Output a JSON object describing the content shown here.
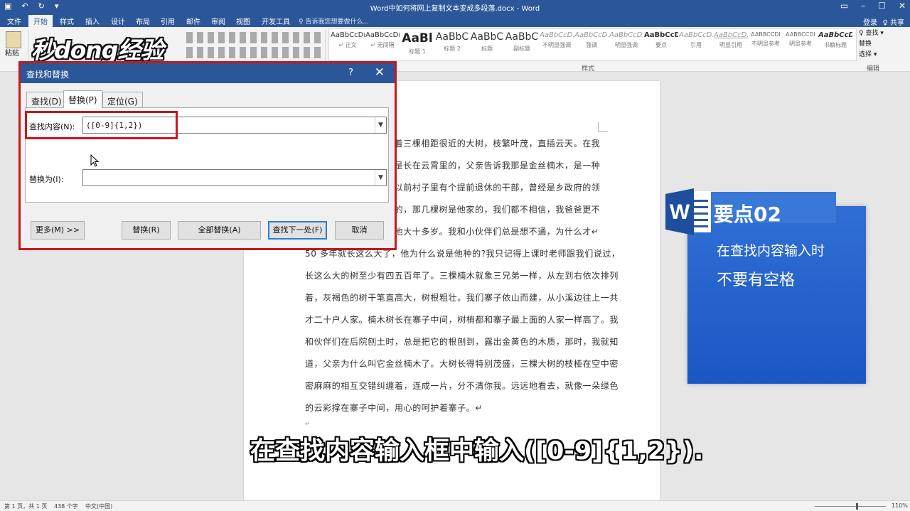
{
  "title_bar": {
    "document_title": "Word中如何将网上复制文本变成多段落.docx - Word",
    "qat_icons": [
      "save-icon",
      "undo-icon",
      "redo-icon",
      "customize-icon"
    ]
  },
  "ribbon_tabs": [
    "文件",
    "开始",
    "样式",
    "插入",
    "设计",
    "布局",
    "引用",
    "邮件",
    "审阅",
    "视图",
    "开发工具"
  ],
  "ribbon_active_tab": "开始",
  "tell_me": "♀ 告诉我您想要做什么...",
  "sign_in": "登录",
  "share": "♀ 共享",
  "clipboard": {
    "paste_label": "粘贴"
  },
  "styles_gallery": [
    {
      "sample": "AaBbCcDı",
      "name": "↵ 正文"
    },
    {
      "sample": "AaBbCcDı",
      "name": "↵ 无间隔"
    },
    {
      "sample": "AaBl",
      "name": "标题 1"
    },
    {
      "sample": "AaBbC",
      "name": "标题 2"
    },
    {
      "sample": "AaBbC",
      "name": "标题"
    },
    {
      "sample": "AaBbC",
      "name": "副标题"
    },
    {
      "sample": "AaBbCcD.",
      "name": "不明显强调"
    },
    {
      "sample": "AaBbCcD.",
      "name": "强调"
    },
    {
      "sample": "AaBbCcD.",
      "name": "明显强调"
    },
    {
      "sample": "AaBbCcD",
      "name": "要点"
    },
    {
      "sample": "AaBbCcD.",
      "name": "引用"
    },
    {
      "sample": "AaBbCcD.",
      "name": "明显引用"
    },
    {
      "sample": "AABBCCDI",
      "name": "不明显参考"
    },
    {
      "sample": "AABBCCDI",
      "name": "明显参考"
    },
    {
      "sample": "AaBbCcD",
      "name": "书籍标题"
    }
  ],
  "styles_group_label": "样式",
  "editing_group": {
    "find": "♀ 查找 ▾",
    "replace": "替换",
    "select": "选择 ▾",
    "label": "编辑"
  },
  "logo_text": "秒dong经验",
  "dialog": {
    "title": "查找和替换",
    "help": "?",
    "close": "✕",
    "tabs": [
      "查找(D)",
      "替换(P)",
      "定位(G)"
    ],
    "active_tab": "替换(P)",
    "find_label": "查找内容(N):",
    "find_value": "([0-9]{1,2})",
    "replace_label": "替换为(I):",
    "replace_value": "",
    "buttons": {
      "more": "更多(M) >>",
      "replace": "替换(R)",
      "replace_all": "全部替换(A)",
      "find_next": "查找下一处(F)",
      "cancel": "取消"
    }
  },
  "document_lines": [
    "长着三棵相距很近的大树，枝繁叶茂，直插云天。在我",
    "叶是长在云霄里的，父亲告诉我那是金丝楠木，是一种",
    "。以前村子里有个提前退休的干部，曾经是乡政府的领",
    "种的，那几棵树是他家的，我们都不相信，我爸爸更不",
    "比他大十多岁。我和小伙伴们总是想不通，为什么才↵",
    "50 多年就长这么大了，他为什么说是他种的?我只记得上课时老师跟我们说过，",
    "长这么大的树至少有四五百年了。三棵楠木就象三兄弟一样，从左到右依次排列",
    "着，灰褐色的树干笔直高大，树根粗壮。我们寨子依山而建，从小溪边往上一共",
    "才二十户人家。楠木树长在寨子中间，树梢都和寨子最上面的人家一样高了。我",
    "和伙伴们在后院刨土时，总是把它的根刨到，露出金黄色的木质，那时，我就知",
    "道，父亲为什么叫它金丝楠木了。大树长得特别茂盛，三棵大树的枝桠在空中密",
    "密麻麻的相互交错纠缠着，连成一片，分不清你我。远远地看去，就像一朵绿色",
    "的云彩撑在寨子中间，用心的呵护着寨子。↵",
    "↵"
  ],
  "point_card": {
    "heading": "要点02",
    "line1": "在查找内容输入时",
    "line2": "不要有空格"
  },
  "subtitle": "在查找内容输入框中输入([0-9]{1,2}).",
  "status_bar": {
    "page": "第 1 页，共 1 页",
    "words": "438 个字",
    "language": "中文(中国)",
    "zoom": "110%"
  },
  "colors": {
    "accent": "#2b579a",
    "highlight_frame": "#c7171c",
    "card": "#2f6fd4"
  }
}
